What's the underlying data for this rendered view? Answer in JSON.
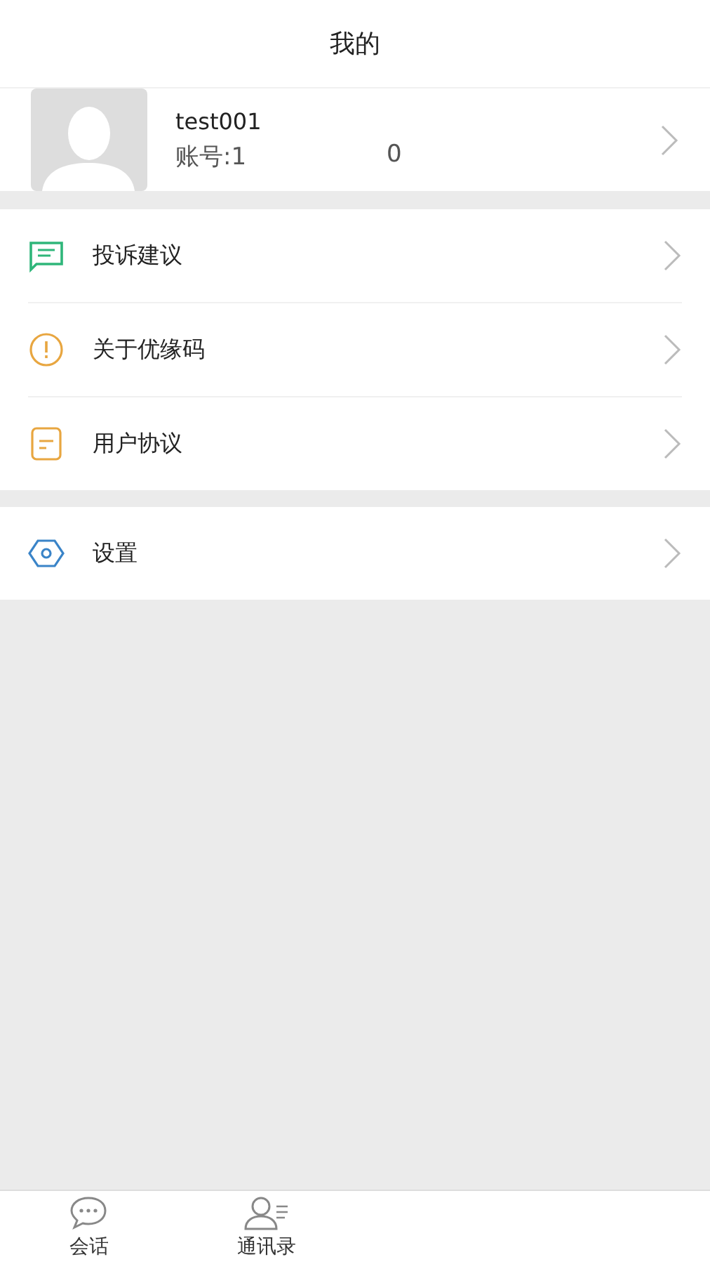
{
  "header": {
    "title": "我的"
  },
  "profile": {
    "name": "test001",
    "account_prefix": "账号:1",
    "account_suffix": "0"
  },
  "menu_groups": [
    [
      {
        "label": "投诉建议",
        "kind": "feedback"
      },
      {
        "label": "关于优缘码",
        "kind": "info"
      },
      {
        "label": "用户协议",
        "kind": "document"
      }
    ],
    [
      {
        "label": "设置",
        "kind": "settings"
      }
    ]
  ],
  "tab_bar": [
    {
      "label": "会话",
      "kind": "chat"
    },
    {
      "label": "通讯录",
      "kind": "contacts"
    }
  ]
}
